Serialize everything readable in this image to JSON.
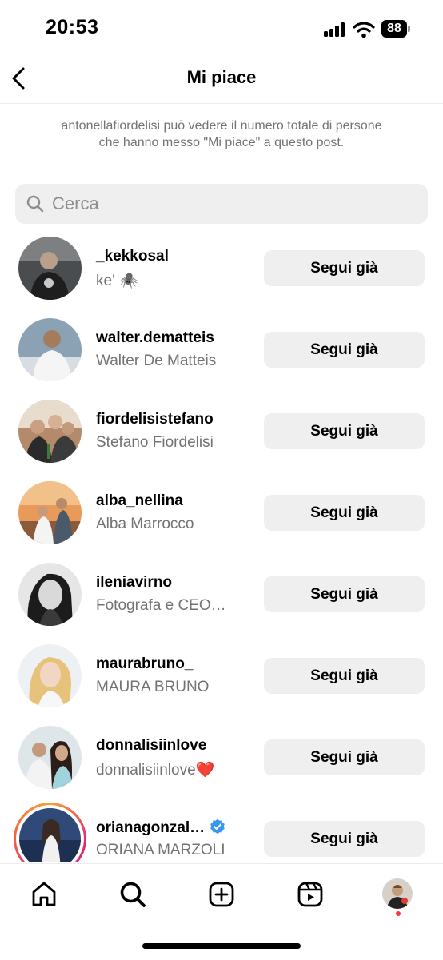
{
  "status_bar": {
    "time": "20:53",
    "battery": "88",
    "icons": [
      "signal-icon",
      "wifi-icon",
      "battery-icon"
    ]
  },
  "header": {
    "back_icon": "chevron-left-icon",
    "title": "Mi piace"
  },
  "info_text": "antonellafiordelisi può vedere il numero totale di persone che hanno messo \"Mi piace\" a questo post.",
  "search": {
    "placeholder": "Cerca",
    "value": "",
    "icon": "search-icon"
  },
  "likers": [
    {
      "username": "_kekkosal",
      "fullname": "ke' 🕷️",
      "button": "Segui già",
      "verified": false,
      "story_ring": false
    },
    {
      "username": "walter.dematteis",
      "fullname": "Walter De Matteis",
      "button": "Segui già",
      "verified": false,
      "story_ring": false
    },
    {
      "username": "fiordelisistefano",
      "fullname": "Stefano Fiordelisi",
      "button": "Segui già",
      "verified": false,
      "story_ring": false
    },
    {
      "username": "alba_nellina",
      "fullname": "Alba Marrocco",
      "button": "Segui già",
      "verified": false,
      "story_ring": false
    },
    {
      "username": "ileniavirno",
      "fullname": "Fotografa e CEO…",
      "button": "Segui già",
      "verified": false,
      "story_ring": false
    },
    {
      "username": "maurabruno_",
      "fullname": "MAURA BRUNO",
      "button": "Segui già",
      "verified": false,
      "story_ring": false
    },
    {
      "username": "donnalisiinlove",
      "fullname": "donnalisiinlove❤️",
      "button": "Segui già",
      "verified": false,
      "story_ring": false
    },
    {
      "username": "orianagonzal…",
      "fullname": "ORIANA MARZOLI",
      "button": "Segui già",
      "verified": true,
      "story_ring": true
    }
  ],
  "bottom_nav": {
    "items": [
      "home-icon",
      "search-icon",
      "create-post-icon",
      "reels-icon",
      "profile-avatar"
    ]
  },
  "colors": {
    "button_bg": "#efeff0",
    "secondary_text": "#737373",
    "verified_blue": "#3897f0",
    "notification_dot": "#ff3040"
  }
}
